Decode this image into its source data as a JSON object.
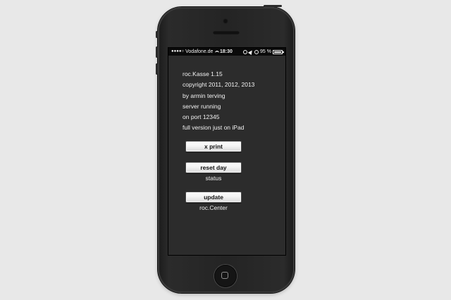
{
  "statusbar": {
    "signal": "●●●●○",
    "carrier": "Vodafone.de",
    "time": "18:30",
    "battery_percent": "95 %"
  },
  "info": {
    "lines": [
      "roc.Kasse 1.15",
      "copyright 2011, 2012, 2013",
      "by armin terving",
      "server running",
      "on port 12345",
      "full version just on iPad"
    ]
  },
  "buttons": {
    "x_print": "x print",
    "reset_day": "reset day",
    "update": "update"
  },
  "captions": {
    "status": "status",
    "roc_center": "roc.Center"
  },
  "colors": {
    "background": "#e8e8e8",
    "phone_body": "#242424",
    "screen": "#2c2c2c",
    "status_bar": "#0a0a0a",
    "text": "#f2f2f2",
    "button": "#f4f4f4"
  },
  "icons": {
    "wifi": "wifi-icon",
    "lock": "lock-rotation-icon",
    "location": "location-arrow-icon",
    "alarm": "alarm-icon",
    "battery": "battery-icon",
    "home": "home-button-icon"
  }
}
